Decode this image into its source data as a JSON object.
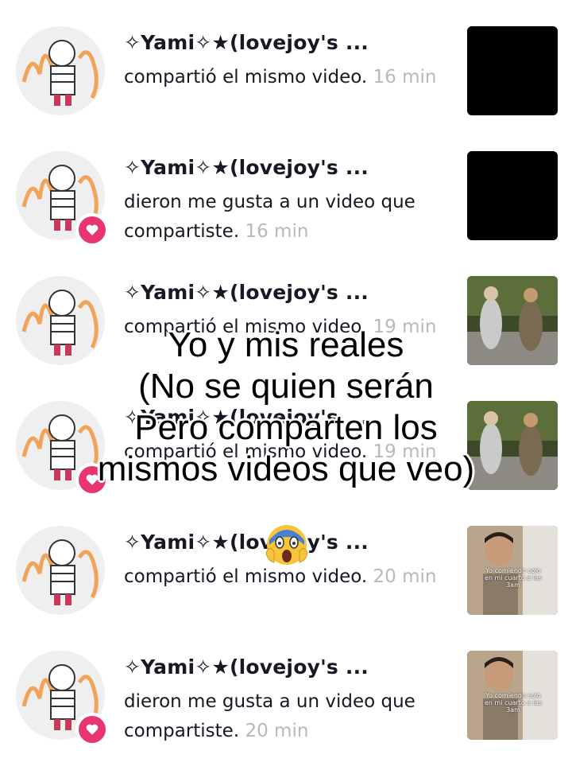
{
  "notifications": [
    {
      "username": "✧Yami✧★(lovejoy's ...",
      "text": "compartió el mismo video.",
      "time": "16 min",
      "liked": false,
      "thumb": "black"
    },
    {
      "username": "✧Yami✧★(lovejoy's ...",
      "text": "dieron me gusta a un video que compartiste.",
      "time": "16 min",
      "liked": true,
      "thumb": "black"
    },
    {
      "username": "✧Yami✧★(lovejoy's ...",
      "text": "compartió el mismo video.",
      "time": "19 min",
      "liked": false,
      "thumb": "action-figures"
    },
    {
      "username": "✧Yami✧★(lovejoy's ...",
      "text": "compartió el mismo video.",
      "time": "19 min",
      "liked": true,
      "thumb": "action-figures"
    },
    {
      "username": "✧Yami✧★(lovejoy's ...",
      "text": "compartió el mismo video.",
      "time": "20 min",
      "liked": false,
      "thumb": "person"
    },
    {
      "username": "✧Yami✧★(lovejoy's ...",
      "text": "dieron me gusta a un video que compartiste.",
      "time": "20 min",
      "liked": true,
      "thumb": "person"
    }
  ],
  "thumb_caption": "Yo comiendo solo en mi cuarto a las 3am",
  "overlay": {
    "line1": "Yo y mis reales",
    "line2": "(No se quien serán",
    "line3": "Pero comparten los",
    "line4": "mismos videos que veo)"
  },
  "emoji": "screaming-face",
  "colors": {
    "heart": "#e8356f",
    "time": "#b8b8bd",
    "text": "#161823"
  }
}
